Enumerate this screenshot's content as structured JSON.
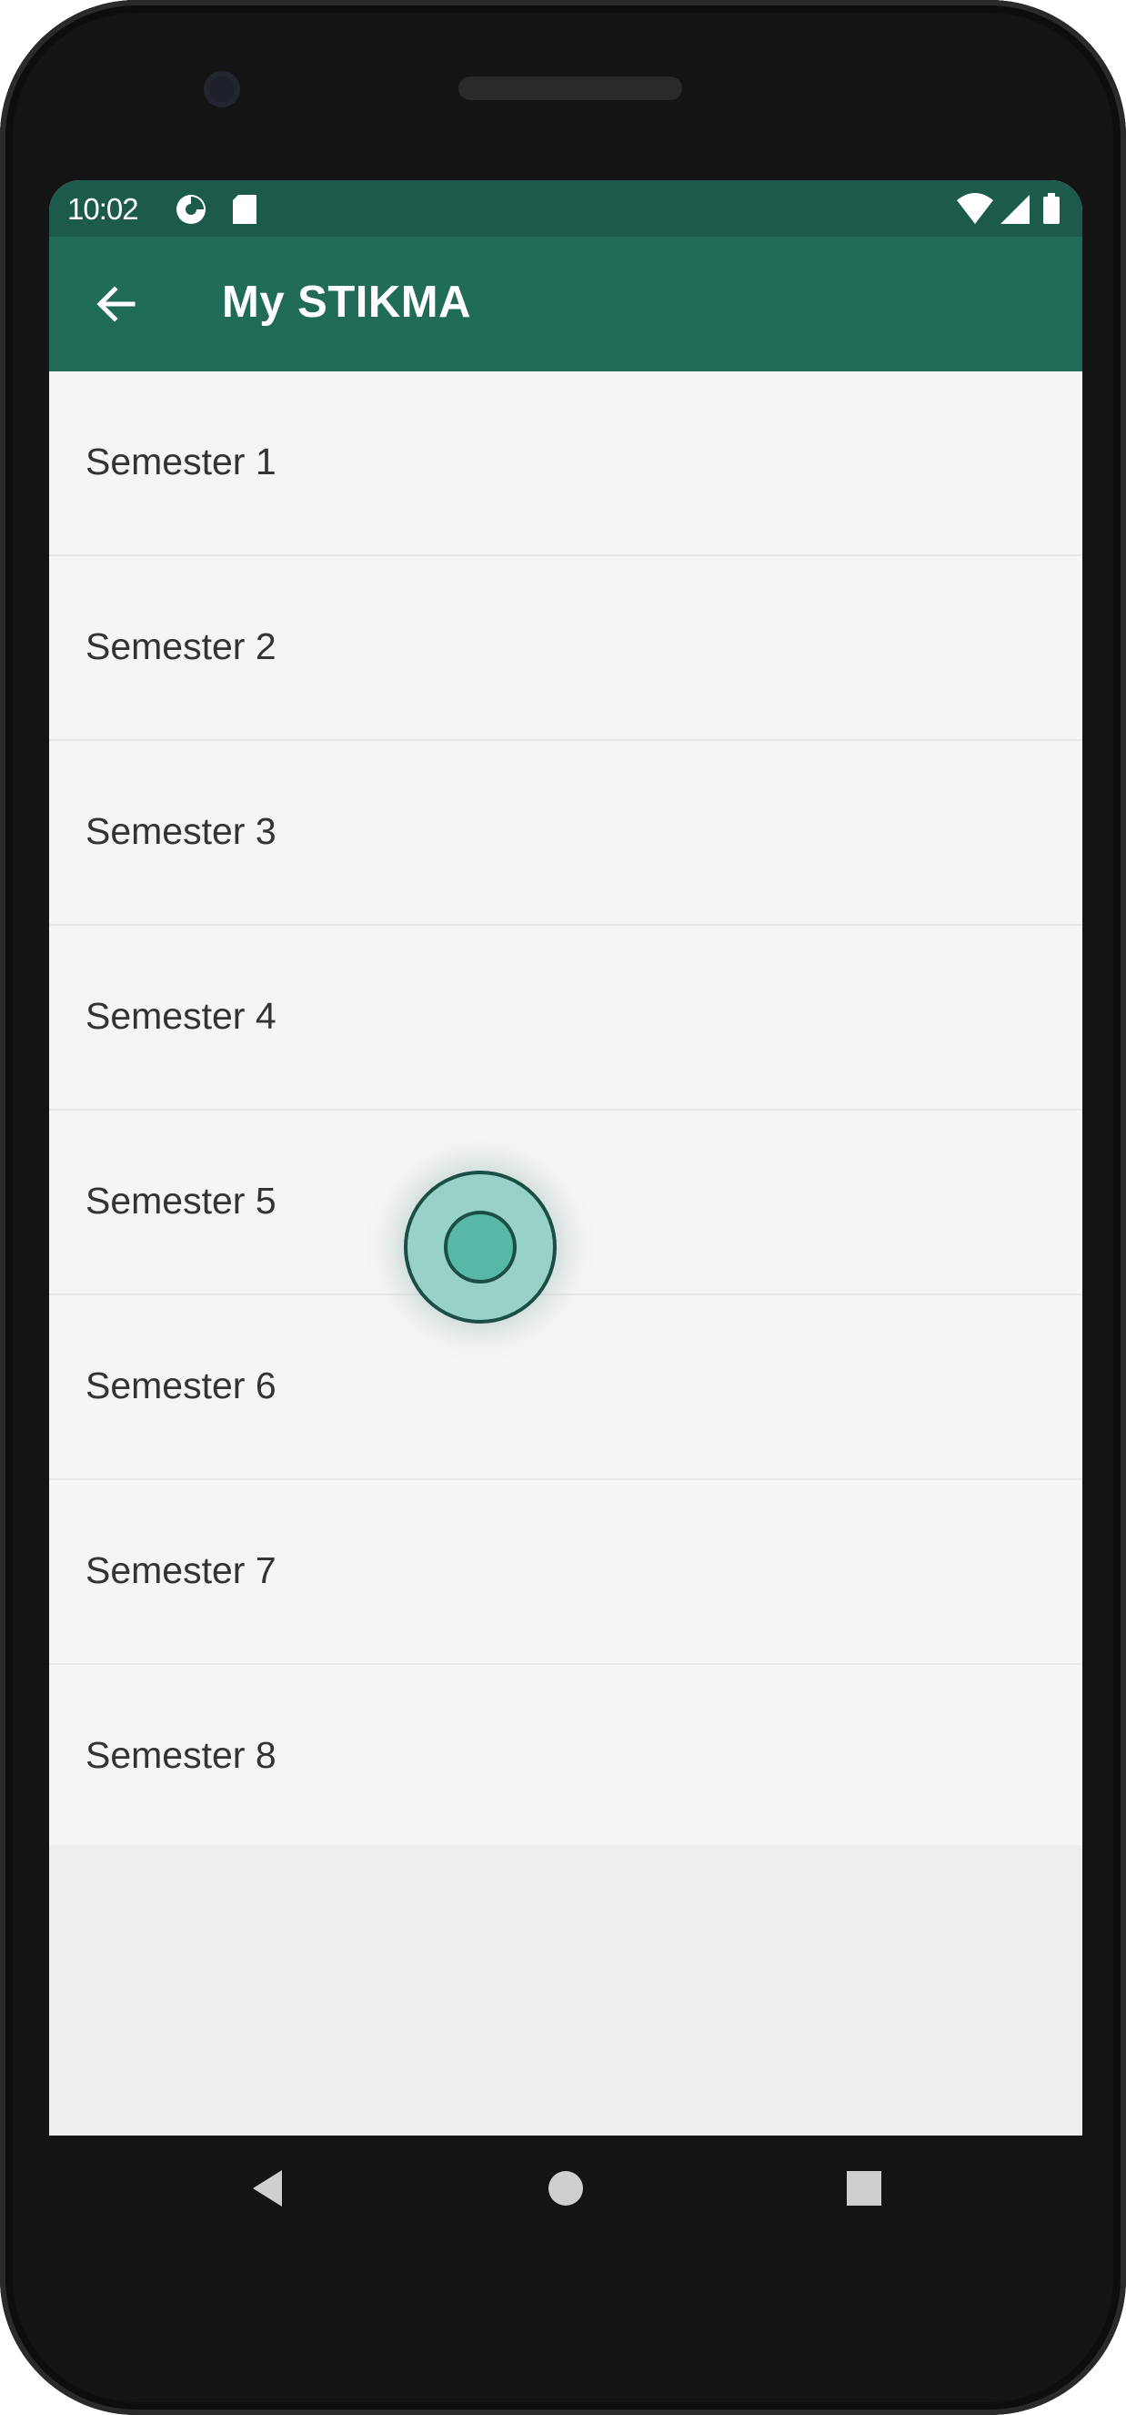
{
  "status_bar": {
    "time": "10:02",
    "left_icons": [
      "data-saver-icon",
      "sd-card-icon"
    ],
    "right_icons": [
      "wifi-icon",
      "signal-icon",
      "battery-icon"
    ]
  },
  "toolbar": {
    "back_icon": "arrow-left-icon",
    "title": "My STIKMA",
    "background": "#216c59"
  },
  "list": {
    "items": [
      {
        "label": "Semester 1"
      },
      {
        "label": "Semester 2"
      },
      {
        "label": "Semester 3"
      },
      {
        "label": "Semester 4"
      },
      {
        "label": "Semester 5"
      },
      {
        "label": "Semester 6"
      },
      {
        "label": "Semester 7"
      },
      {
        "label": "Semester 8"
      }
    ]
  },
  "nav_bar": {
    "buttons": [
      "back-triangle-icon",
      "home-circle-icon",
      "recents-square-icon"
    ]
  },
  "colors": {
    "status_bar": "#1c5a4b",
    "toolbar": "#216c59",
    "touch_indicator": "#58b8a6"
  }
}
